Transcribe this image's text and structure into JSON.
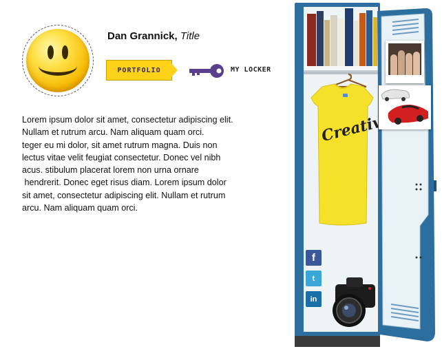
{
  "profile": {
    "name": "Dan Grannick,",
    "title": "Title",
    "avatar_icon": "smiley-face-icon"
  },
  "nav": {
    "portfolio_label": "PORTFOLIO",
    "my_locker_label": "MY LOCKER",
    "key_icon": "key-icon",
    "accent_color": "#ffd21a",
    "key_color": "#5b3f8f"
  },
  "bio": {
    "lines": [
      "Lorem ipsum dolor sit amet, consectetur adipiscing elit.",
      "Nullam et rutrum arcu. Nam aliquam quam orci.",
      "teger eu mi dolor, sit amet rutrum magna. Duis non",
      "lectus vitae velit feugiat consectetur. Donec vel nibh",
      "acus. stibulum placerat lorem non urna ornare",
      " hendrerit. Donec eget risus diam. Lorem ipsum dolor",
      "sit amet, consectetur adipiscing elit. Nullam et rutrum",
      "arcu. Nam aliquam quam orci."
    ]
  },
  "locker": {
    "color": "#2c6f9e",
    "shirt_text": "Creative",
    "social": {
      "facebook": "f",
      "twitter": "t",
      "linkedin": "in"
    },
    "items": [
      "books-shelf",
      "creative-shirt",
      "camera-icon",
      "friends-photo",
      "sports-car-photo"
    ]
  }
}
